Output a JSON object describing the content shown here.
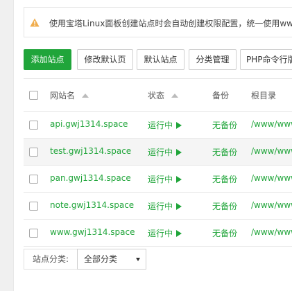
{
  "notice": {
    "icon": "warning-icon",
    "text": "使用宝塔Linux面板创建站点时会自动创建权限配置，统一使用www"
  },
  "toolbar": {
    "buttons": [
      {
        "label": "添加站点",
        "primary": true
      },
      {
        "label": "修改默认页"
      },
      {
        "label": "默认站点"
      },
      {
        "label": "分类管理"
      },
      {
        "label": "PHP命令行版"
      }
    ]
  },
  "table": {
    "headers": {
      "name": "网站名",
      "status": "状态",
      "backup": "备份",
      "root": "根目录"
    },
    "rows": [
      {
        "name": "api.gwj1314.space",
        "status": "运行中",
        "backup": "无备份",
        "root": "/www/www"
      },
      {
        "name": "test.gwj1314.space",
        "status": "运行中",
        "backup": "无备份",
        "root": "/www/www"
      },
      {
        "name": "pan.gwj1314.space",
        "status": "运行中",
        "backup": "无备份",
        "root": "/www/www"
      },
      {
        "name": "note.gwj1314.space",
        "status": "运行中",
        "backup": "无备份",
        "root": "/www/www"
      },
      {
        "name": "www.gwj1314.space",
        "status": "运行中",
        "backup": "无备份",
        "root": "/www/www"
      }
    ]
  },
  "footer": {
    "category_label": "站点分类:",
    "category_value": "全部分类"
  },
  "colors": {
    "accent": "#20a53a",
    "warning": "#f0ad4e"
  }
}
